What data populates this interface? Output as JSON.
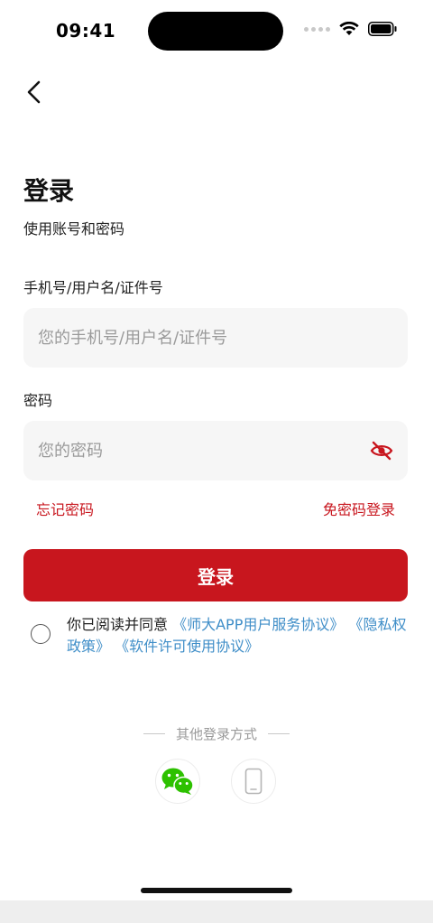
{
  "status_bar": {
    "time": "09:41",
    "icons": [
      "signal-icon",
      "wifi-icon",
      "battery-icon"
    ]
  },
  "header": {
    "back_icon": "chevron-left-icon",
    "title": "登录",
    "subtitle": "使用账号和密码"
  },
  "form": {
    "account_label": "手机号/用户名/证件号",
    "account_placeholder": "您的手机号/用户名/证件号",
    "account_value": "",
    "password_label": "密码",
    "password_placeholder": "您的密码",
    "password_value": "",
    "password_toggle_icon": "eye-off-icon",
    "forgot_label": "忘记密码",
    "passwordless_label": "免密码登录",
    "submit_label": "登录"
  },
  "agreement": {
    "checked": false,
    "prefix": "你已阅读并同意",
    "link1": "《师大APP用户服务协议》",
    "link2": "《隐私权政策》",
    "link3": "《软件许可使用协议》"
  },
  "other_login": {
    "label": "其他登录方式",
    "options": [
      {
        "icon": "wechat-icon"
      },
      {
        "icon": "phone-icon"
      }
    ]
  },
  "colors": {
    "accent": "#c8161e",
    "link": "#3f8ec8",
    "input_bg": "#f6f6f6",
    "wechat": "#2dc100"
  }
}
